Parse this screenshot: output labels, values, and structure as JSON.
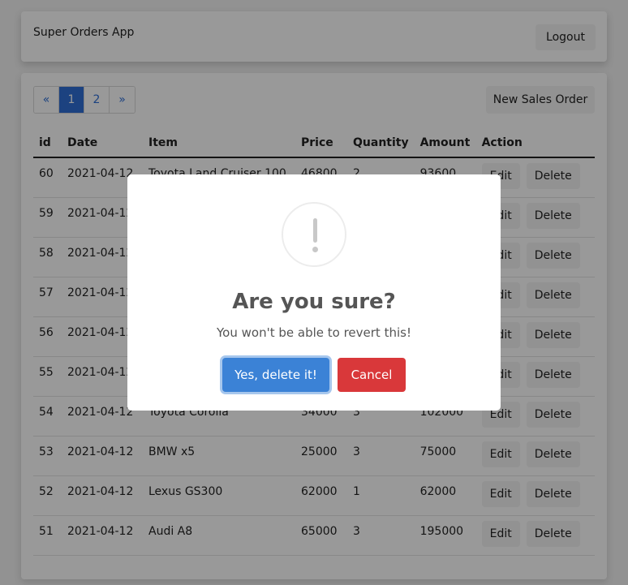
{
  "navbar": {
    "brand": "Super Orders App",
    "logout_label": "Logout"
  },
  "pagination": {
    "prev": "«",
    "pages": [
      "1",
      "2"
    ],
    "current": "1",
    "next": "»"
  },
  "toolbar": {
    "new_order_label": "New Sales Order"
  },
  "table": {
    "headers": [
      "id",
      "Date",
      "Item",
      "Price",
      "Quantity",
      "Amount",
      "Action"
    ],
    "edit_label": "Edit",
    "delete_label": "Delete",
    "rows": [
      {
        "id": "60",
        "date": "2021-04-12",
        "item": "Toyota Land Cruiser 100",
        "price": "46800",
        "quantity": "2",
        "amount": "93600"
      },
      {
        "id": "59",
        "date": "2021-04-12",
        "item": "",
        "price": "",
        "quantity": "",
        "amount": ""
      },
      {
        "id": "58",
        "date": "2021-04-12",
        "item": "",
        "price": "",
        "quantity": "",
        "amount": ""
      },
      {
        "id": "57",
        "date": "2021-04-12",
        "item": "",
        "price": "",
        "quantity": "",
        "amount": ""
      },
      {
        "id": "56",
        "date": "2021-04-12",
        "item": "",
        "price": "",
        "quantity": "",
        "amount": ""
      },
      {
        "id": "55",
        "date": "2021-04-12",
        "item": "",
        "price": "",
        "quantity": "",
        "amount": ""
      },
      {
        "id": "54",
        "date": "2021-04-12",
        "item": "Toyota Corolla",
        "price": "34000",
        "quantity": "3",
        "amount": "102000"
      },
      {
        "id": "53",
        "date": "2021-04-12",
        "item": "BMW x5",
        "price": "25000",
        "quantity": "3",
        "amount": "75000"
      },
      {
        "id": "52",
        "date": "2021-04-12",
        "item": "Lexus GS300",
        "price": "62000",
        "quantity": "1",
        "amount": "62000"
      },
      {
        "id": "51",
        "date": "2021-04-12",
        "item": "Audi A8",
        "price": "65000",
        "quantity": "3",
        "amount": "195000"
      }
    ]
  },
  "modal": {
    "icon": "warning-exclamation-icon",
    "title": "Are you sure?",
    "text": "You won't be able to revert this!",
    "confirm_label": "Yes, delete it!",
    "cancel_label": "Cancel"
  },
  "colors": {
    "primary": "#2f6fd6",
    "confirm": "#3b82d6",
    "danger": "#d9383a"
  }
}
